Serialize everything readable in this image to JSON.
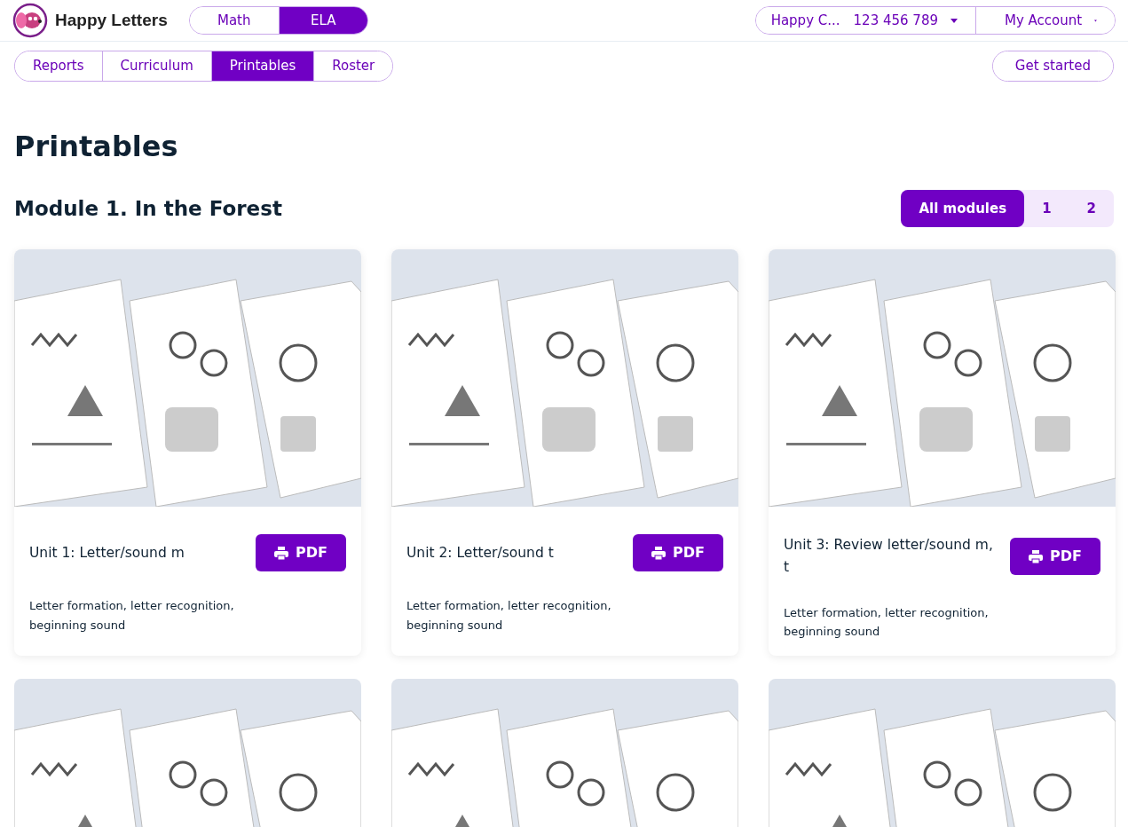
{
  "brand": {
    "name": "Happy Letters"
  },
  "subjects": [
    {
      "label": "Math",
      "selected": false
    },
    {
      "label": "ELA",
      "selected": true
    }
  ],
  "account": {
    "school": "Happy C...",
    "number": "123 456 789",
    "menu": "My Account"
  },
  "nav_tabs": [
    {
      "label": "Reports",
      "selected": false
    },
    {
      "label": "Curriculum",
      "selected": false
    },
    {
      "label": "Printables",
      "selected": true
    },
    {
      "label": "Roster",
      "selected": false
    }
  ],
  "get_started": "Get started",
  "page_title": "Printables",
  "module": {
    "title": "Module 1. In the Forest",
    "filters": [
      {
        "label": "All modules",
        "selected": true
      },
      {
        "label": "1",
        "selected": false
      },
      {
        "label": "2",
        "selected": false
      }
    ],
    "cards": [
      {
        "kind": "full",
        "title": "Unit 1: Letter/sound m",
        "button": "PDF",
        "description": "Letter formation, letter recognition, beginning sound"
      },
      {
        "kind": "full",
        "title": "Unit 2: Letter/sound t",
        "button": "PDF",
        "description": "Letter formation, letter recognition, beginning sound"
      },
      {
        "kind": "full",
        "title": "Unit 3: Review letter/sound m, t",
        "button": "PDF",
        "description": "Letter formation, letter recognition, beginning sound"
      },
      {
        "kind": "preview_only"
      },
      {
        "kind": "preview_only"
      },
      {
        "kind": "preview_only"
      }
    ]
  }
}
